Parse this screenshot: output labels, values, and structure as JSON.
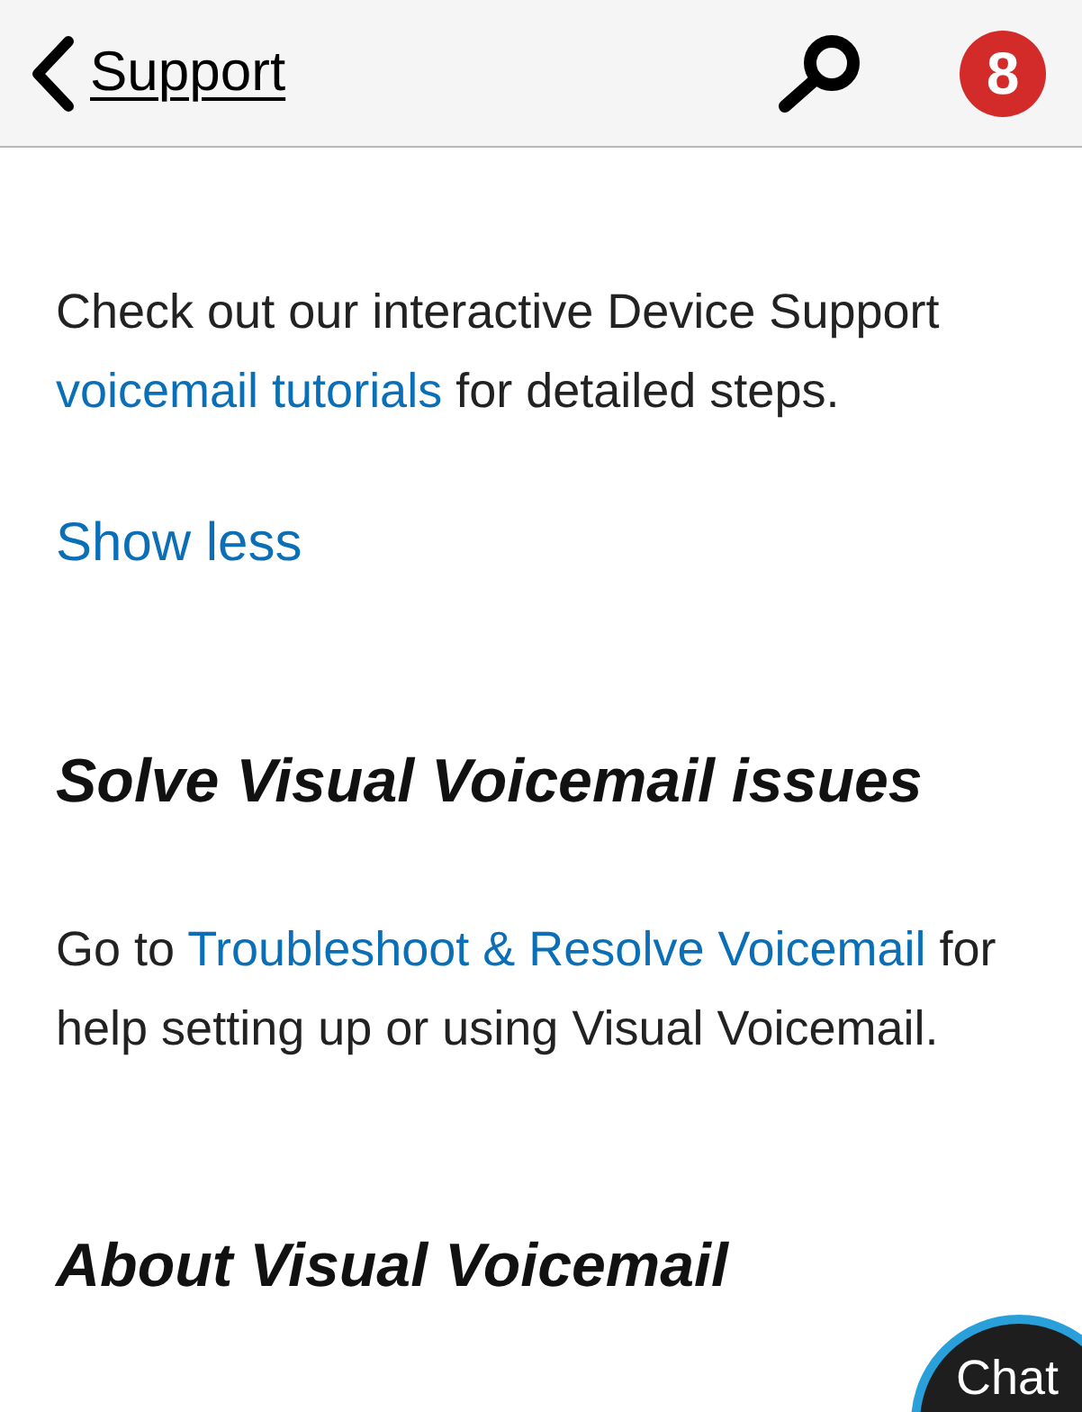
{
  "header": {
    "back_label": "Support",
    "badge": "8"
  },
  "intro": [
    {
      "kind": "text",
      "text": "Check out our interactive Device Support "
    },
    {
      "kind": "link",
      "text": "voicemail tutorials"
    },
    {
      "kind": "text",
      "text": " for detailed steps."
    }
  ],
  "toggle_link": "Show less",
  "sections": [
    {
      "heading": "Solve Visual Voicemail issues",
      "body": [
        {
          "kind": "text",
          "text": "Go to "
        },
        {
          "kind": "link",
          "text": "Troubleshoot & Resolve Voicemail"
        },
        {
          "kind": "text",
          "text": " for help setting up or using Visual Voicemail."
        }
      ]
    },
    {
      "heading": "About Visual Voicemail"
    }
  ],
  "chat_button": "Chat"
}
